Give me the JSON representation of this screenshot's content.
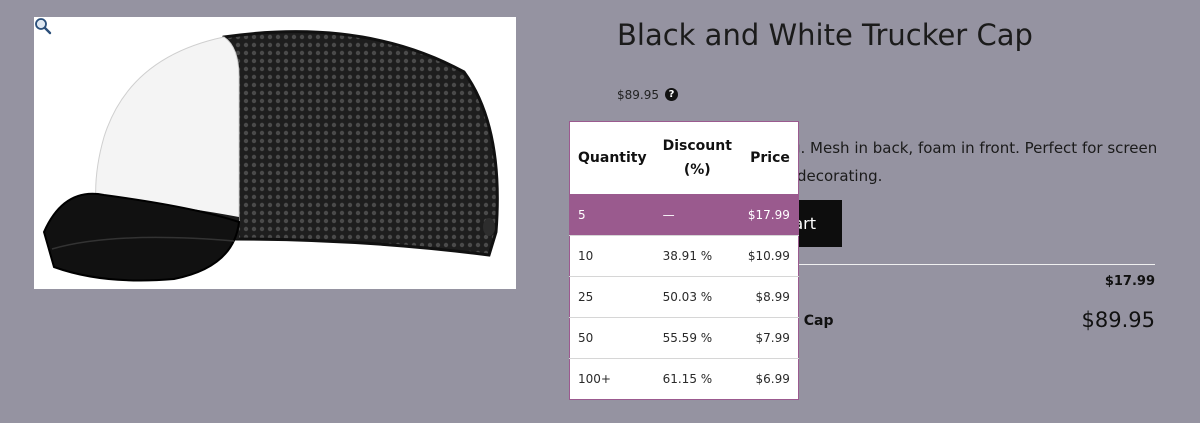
{
  "product": {
    "title": "Black and White Trucker Cap",
    "price_text": "$89.95",
    "description": "g. Mesh in back, foam in front. Perfect for screen",
    "description_line2": "decorating.",
    "add_to_cart_label": "art",
    "unit_price": "$17.99",
    "variant_label": "r Cap",
    "total_price": "$89.95",
    "image_alt": "black-and-white-trucker-cap-icon"
  },
  "tiers": {
    "headers": [
      "Quantity",
      "Discount (%)",
      "Price"
    ],
    "rows": [
      [
        "5",
        "—",
        "$17.99"
      ],
      [
        "10",
        "38.91 %",
        "$10.99"
      ],
      [
        "25",
        "50.03 %",
        "$8.99"
      ],
      [
        "50",
        "55.59 %",
        "$7.99"
      ],
      [
        "100+",
        "61.15 %",
        "$6.99"
      ]
    ],
    "selected_index": 0
  },
  "colors": {
    "background": "#9593a1",
    "accent": "#9a5a8e",
    "button": "#0d0d0d"
  }
}
